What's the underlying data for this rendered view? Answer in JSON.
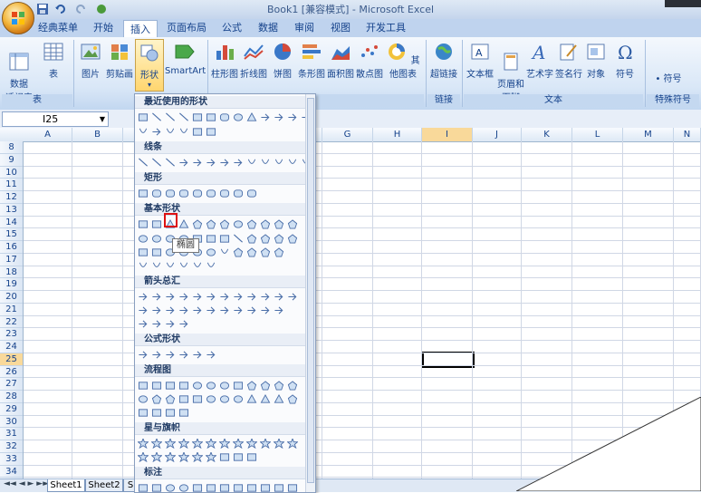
{
  "window": {
    "title": "Book1  [兼容模式] - Microsoft Excel"
  },
  "tabs": [
    {
      "label": "经典菜单"
    },
    {
      "label": "开始"
    },
    {
      "label": "插入"
    },
    {
      "label": "页面布局"
    },
    {
      "label": "公式"
    },
    {
      "label": "数据"
    },
    {
      "label": "审阅"
    },
    {
      "label": "视图"
    },
    {
      "label": "开发工具"
    }
  ],
  "ribbon": {
    "pivot": "数据\n透视表",
    "table": "表",
    "picture": "图片",
    "clipart": "剪贴画",
    "shapes": "形状",
    "smartart": "SmartArt",
    "column": "柱形图",
    "line": "折线图",
    "pie": "饼图",
    "bar": "条形图",
    "area": "面积图",
    "scatter": "散点图",
    "other": "其他图表",
    "hyperlink": "超链接",
    "textbox": "文本框",
    "header": "页眉和\n页脚",
    "wordart": "艺术字",
    "signature": "签名行",
    "object": "对象",
    "symbol": "符号",
    "special_symbol": "符号",
    "groups": {
      "tables": "表",
      "links": "链接",
      "text": "文本",
      "special": "特殊符号"
    }
  },
  "formula": {
    "namebox": "I25"
  },
  "columns": [
    "A",
    "B",
    "C",
    "D",
    "E",
    "F",
    "G",
    "H",
    "I",
    "J",
    "K",
    "L",
    "M",
    "N"
  ],
  "selected_column": "I",
  "rows": [
    "8",
    "9",
    "10",
    "11",
    "12",
    "13",
    "14",
    "15",
    "16",
    "17",
    "18",
    "19",
    "20",
    "21",
    "22",
    "23",
    "24",
    "25",
    "26",
    "27",
    "28",
    "29",
    "30",
    "31",
    "32",
    "33",
    "34"
  ],
  "selected_row": "25",
  "sheets": [
    "Sheet1",
    "Sheet2",
    "S"
  ],
  "shapes_menu": {
    "categories": [
      "最近使用的形状",
      "线条",
      "矩形",
      "基本形状",
      "箭头总汇",
      "公式形状",
      "流程图",
      "星与旗帜",
      "标注"
    ],
    "tooltip": "椭圆"
  },
  "colors": {
    "accent": "#15428b",
    "selected_header": "#f9d99a",
    "highlight": "#dd1111"
  }
}
